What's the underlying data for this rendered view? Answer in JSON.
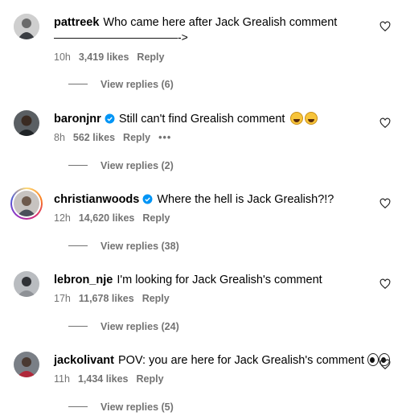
{
  "reply_label": "Reply",
  "more_label": "•••",
  "comments": [
    {
      "username": "pattreek",
      "verified": false,
      "text": "Who came here after Jack Grealish comment",
      "text_line2": "———————————->",
      "time": "10h",
      "likes": "3,419 likes",
      "replies": "View replies (6)",
      "emoji": ""
    },
    {
      "username": "baronjnr",
      "verified": true,
      "text": "Still can't find Grealish comment",
      "time": "8h",
      "likes": "562 likes",
      "replies": "View replies (2)",
      "emoji": "rolling-on-floor-laughing x2"
    },
    {
      "username": "christianwoods",
      "verified": true,
      "text": "Where the hell is Jack Grealish?!?",
      "time": "12h",
      "likes": "14,620 likes",
      "replies": "View replies (38)",
      "emoji": ""
    },
    {
      "username": "lebron_nje",
      "verified": false,
      "text": "I'm looking for Jack Grealish's comment",
      "time": "17h",
      "likes": "11,678 likes",
      "replies": "View replies (24)",
      "emoji": ""
    },
    {
      "username": "jackolivant",
      "verified": false,
      "text": "POV: you are here for Jack Grealish's comment",
      "time": "11h",
      "likes": "1,434 likes",
      "replies": "View replies (5)",
      "emoji": "eyes"
    }
  ],
  "colors": {
    "secondary_text": "#737373",
    "verified_badge": "#0095f6"
  }
}
